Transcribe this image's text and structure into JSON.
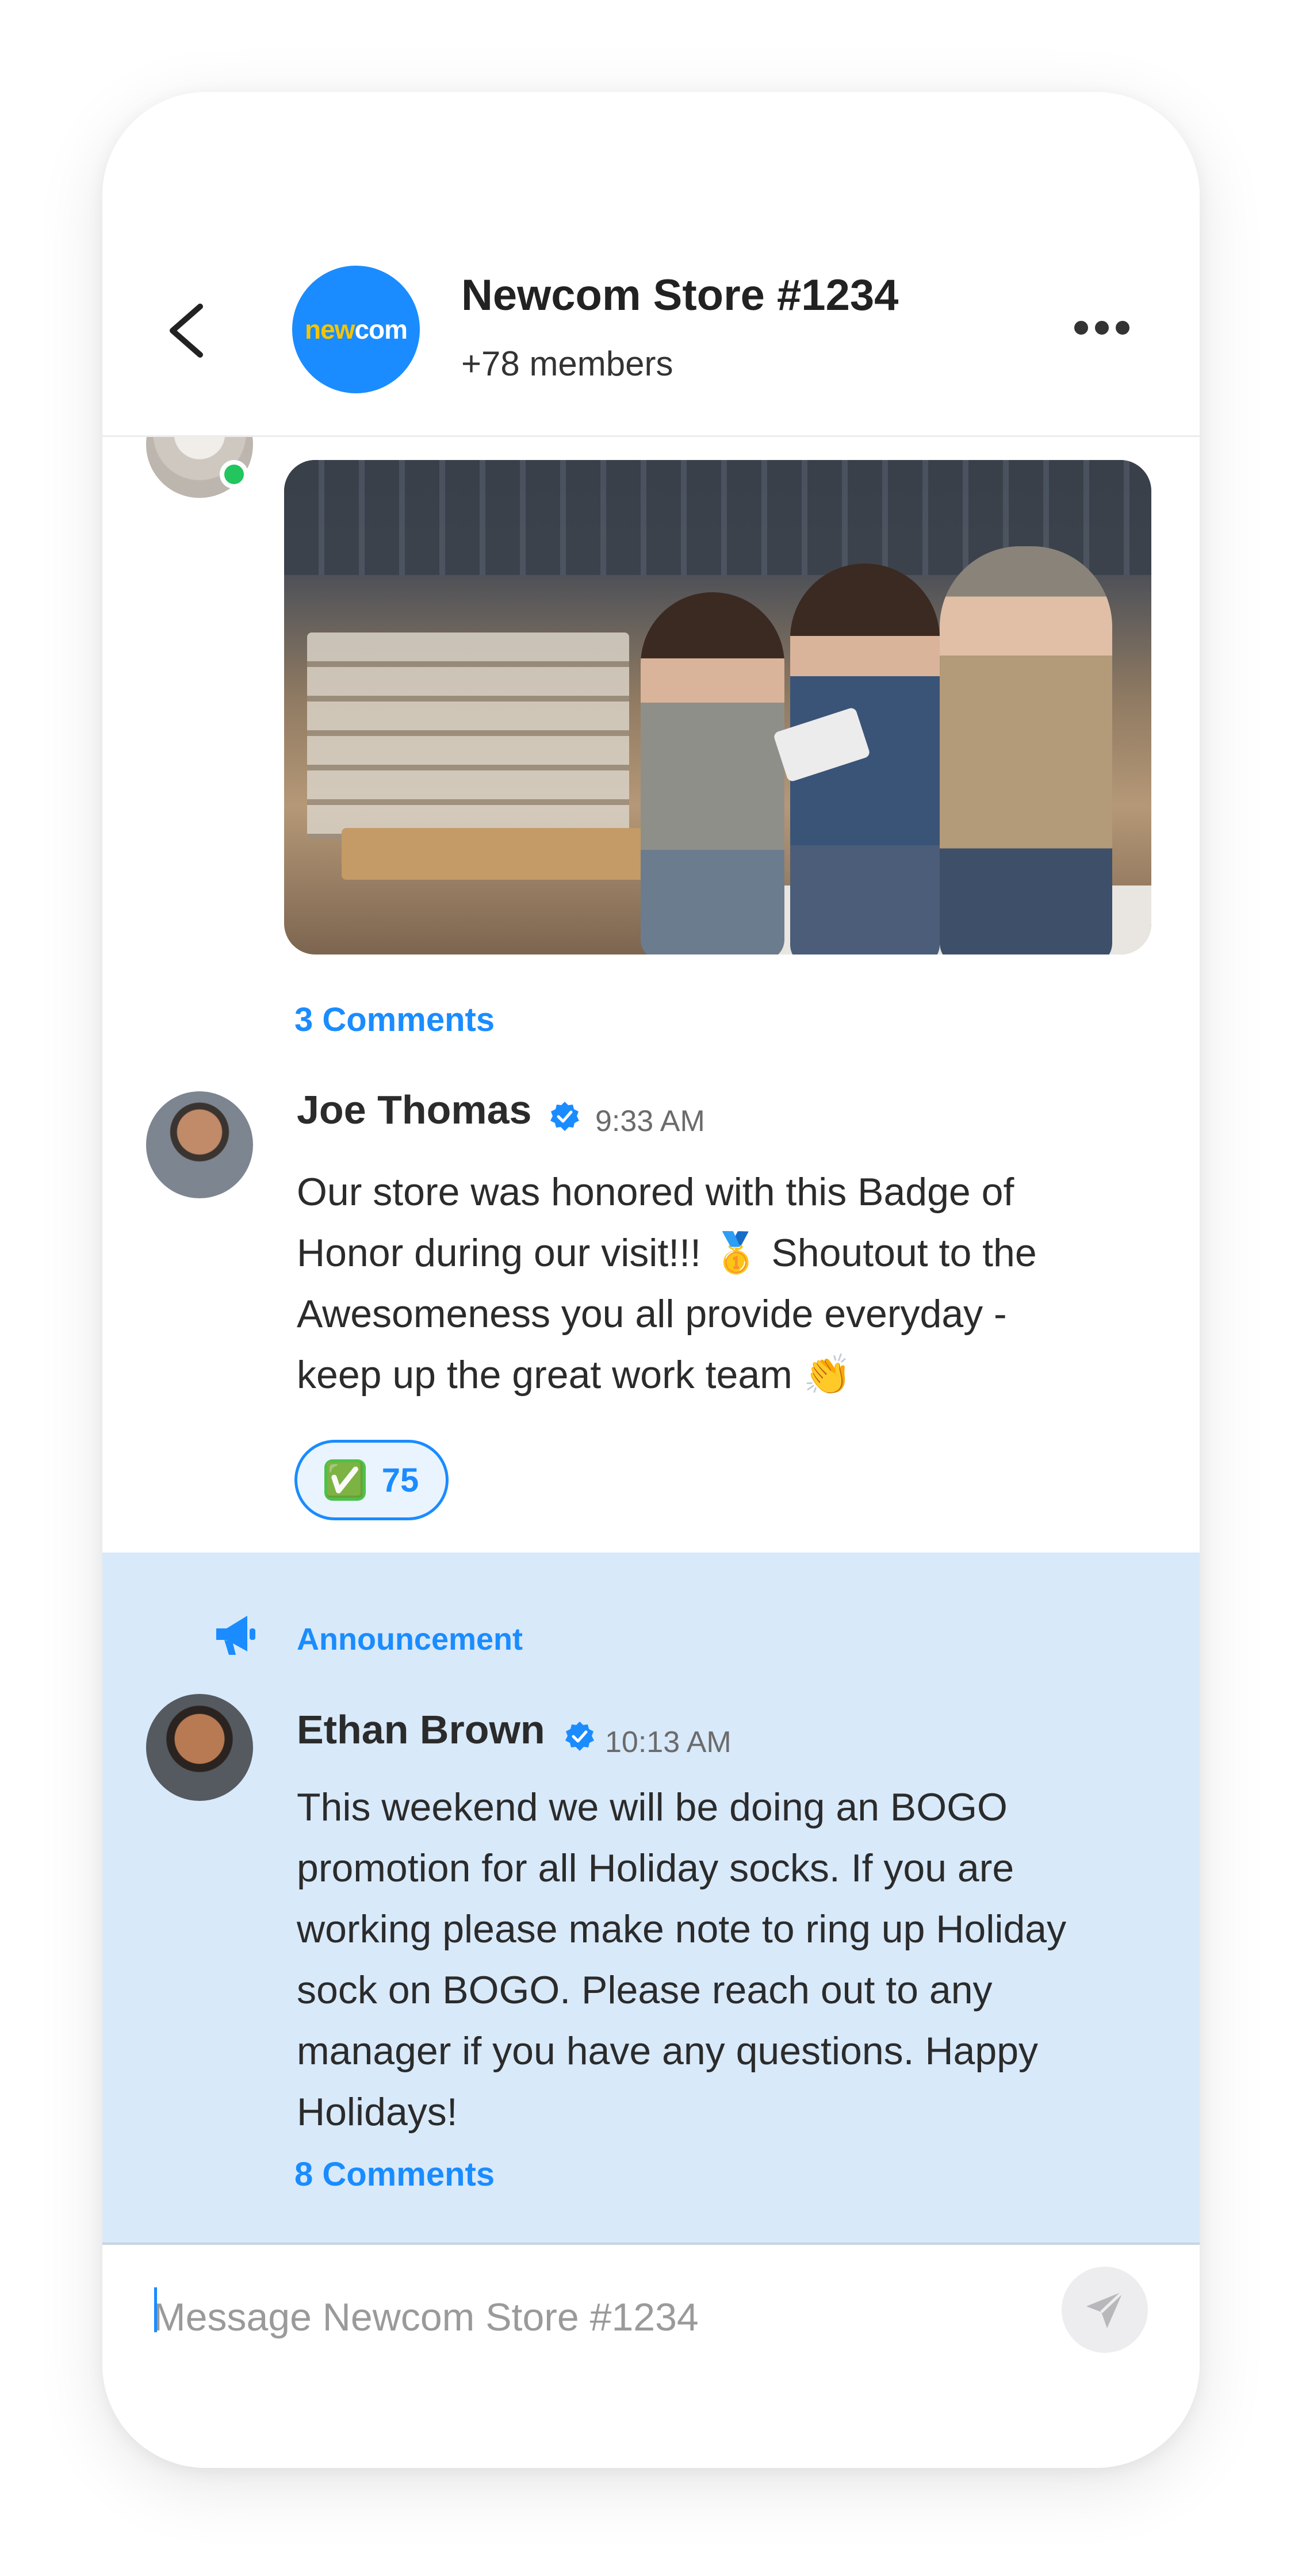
{
  "header": {
    "title": "Newcom Store #1234",
    "members": "+78 members",
    "logo_text_highlight": "new",
    "logo_text_rest": "com"
  },
  "top_post": {
    "comments_link": "3 Comments",
    "author_online": true
  },
  "messages": [
    {
      "author": "Joe Thomas",
      "verified": true,
      "time": "9:33 AM",
      "body": "Our store was honored with this Badge of\nHonor during our visit!!! 🥇 Shoutout to the\nAwesomeness you all provide everyday -\nkeep up the great work team 👏",
      "reaction": {
        "emoji": "✅",
        "count": "75"
      }
    }
  ],
  "announcement": {
    "label": "Announcement",
    "author": "Ethan Brown",
    "verified": true,
    "time": "10:13 AM",
    "body": "This weekend we will be doing an BOGO\npromotion for all Holiday socks. If you are\nworking please make note to ring up Holiday\nsock on BOGO. Please reach out to any\nmanager if you have any questions. Happy\nHolidays!",
    "comments_link": "8 Comments"
  },
  "composer": {
    "placeholder": "Message Newcom Store #1234",
    "value": ""
  },
  "colors": {
    "accent": "#1a8cff",
    "announcement_bg": "#d8e9fa",
    "online": "#22c55e",
    "reaction_check": "#4cc24a"
  },
  "icons": {
    "back": "chevron-left-icon",
    "more": "more-horizontal-icon",
    "verified": "verified-check-icon",
    "announcement": "megaphone-icon",
    "send": "send-icon"
  }
}
